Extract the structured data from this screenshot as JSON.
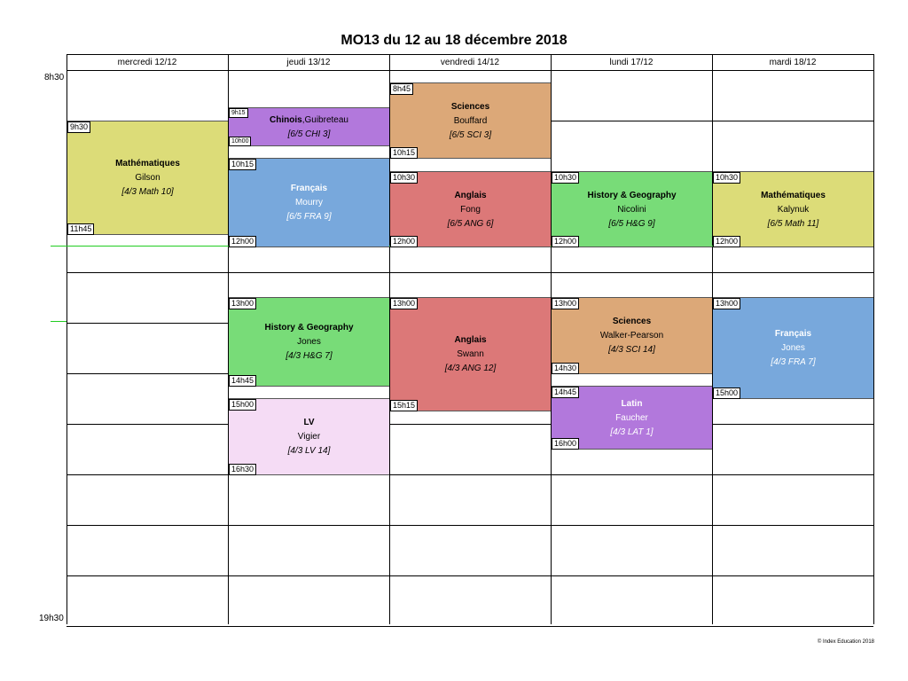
{
  "title": "MO13 du 12 au 18 décembre 2018",
  "days": [
    "mercredi 12/12",
    "jeudi 13/12",
    "vendredi 14/12",
    "lundi 17/12",
    "mardi 18/12"
  ],
  "time_labels": {
    "start": "8h30",
    "end": "19h30"
  },
  "footer": "© Index Education 2018",
  "courses": [
    {
      "day": 0,
      "start": "9h30",
      "end": "11h45",
      "subject": "Mathématiques",
      "teacher": "Gilson",
      "group": "[4/3 Math 10]",
      "color": "#dcdc78"
    },
    {
      "day": 1,
      "start": "9h15",
      "end": "10h00",
      "subject": "Chinois",
      "teacher": "Guibreteau",
      "group": "[6/5 CHI 3]",
      "color": "#b278dc",
      "inline": true,
      "small_times": true
    },
    {
      "day": 1,
      "start": "10h15",
      "end": "12h00",
      "subject": "Français",
      "teacher": "Mourry",
      "group": "[6/5 FRA 9]",
      "color": "#78a8dc",
      "white_text": true
    },
    {
      "day": 2,
      "start": "8h45",
      "end": "10h15",
      "subject": "Sciences",
      "teacher": "Bouffard",
      "group": "[6/5 SCI 3]",
      "color": "#dca878"
    },
    {
      "day": 2,
      "start": "10h30",
      "end": "12h00",
      "subject": "Anglais",
      "teacher": "Fong",
      "group": "[6/5 ANG 6]",
      "color": "#dc7878"
    },
    {
      "day": 3,
      "start": "10h30",
      "end": "12h00",
      "subject": "History & Geography",
      "teacher": "Nicolini",
      "group": "[6/5 H&G 9]",
      "color": "#78dc78"
    },
    {
      "day": 4,
      "start": "10h30",
      "end": "12h00",
      "subject": "Mathématiques",
      "teacher": "Kalynuk",
      "group": "[6/5 Math 11]",
      "color": "#dcdc78"
    },
    {
      "day": 1,
      "start": "13h00",
      "end": "14h45",
      "subject": "History & Geography",
      "teacher": "Jones",
      "group": "[4/3 H&G 7]",
      "color": "#78dc78"
    },
    {
      "day": 1,
      "start": "15h00",
      "end": "16h30",
      "subject": "LV",
      "teacher": "Vigier",
      "group": "[4/3 LV 14]",
      "color": "#f5dcf5"
    },
    {
      "day": 2,
      "start": "13h00",
      "end": "15h15",
      "subject": "Anglais",
      "teacher": "Swann",
      "group": "[4/3 ANG 12]",
      "color": "#dc7878"
    },
    {
      "day": 3,
      "start": "13h00",
      "end": "14h30",
      "subject": "Sciences",
      "teacher": "Walker-Pearson",
      "group": "[4/3 SCI 14]",
      "color": "#dca878"
    },
    {
      "day": 3,
      "start": "14h45",
      "end": "16h00",
      "subject": "Latin",
      "teacher": "Faucher",
      "group": "[4/3 LAT 1]",
      "color": "#b278dc",
      "white_text": true
    },
    {
      "day": 4,
      "start": "13h00",
      "end": "15h00",
      "subject": "Français",
      "teacher": "Jones",
      "group": "[4/3 FRA 7]",
      "color": "#78a8dc",
      "white_text": true
    }
  ]
}
